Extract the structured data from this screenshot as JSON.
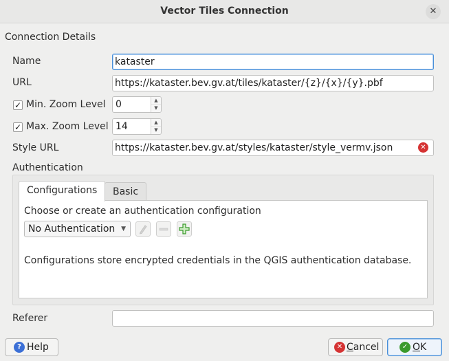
{
  "window": {
    "title": "Vector Tiles Connection",
    "close_glyph": "✕"
  },
  "connection": {
    "group_title": "Connection Details",
    "name_label": "Name",
    "name_value": "kataster",
    "url_label": "URL",
    "url_value": "https://kataster.bev.gv.at/tiles/kataster/{z}/{x}/{y}.pbf",
    "min_zoom_label": "Min. Zoom Level",
    "min_zoom_checked": true,
    "min_zoom_value": "0",
    "max_zoom_label": "Max. Zoom Level",
    "max_zoom_checked": true,
    "max_zoom_value": "14",
    "style_url_label": "Style URL",
    "style_url_value": "https://kataster.bev.gv.at/styles/kataster/style_vermv.json",
    "check_glyph": "✓"
  },
  "authentication": {
    "group_title": "Authentication",
    "tabs": [
      {
        "label": "Configurations",
        "active": true
      },
      {
        "label": "Basic",
        "active": false
      }
    ],
    "choose_text": "Choose or create an authentication configuration",
    "selected_config": "No Authentication",
    "info_text": "Configurations store encrypted credentials in the QGIS authentication database."
  },
  "referer": {
    "label": "Referer",
    "value": ""
  },
  "buttons": {
    "help": "Help",
    "cancel": "Cancel",
    "ok": "OK"
  },
  "icons": {
    "clear": "clear-field-icon",
    "edit": "pencil-icon",
    "remove": "remove-icon",
    "add": "green-plus-icon",
    "help": "question-icon",
    "cancel": "red-x-icon",
    "ok": "green-check-icon"
  },
  "colors": {
    "focus": "#4a90d9",
    "add_green": "#3a9a2c",
    "clear_red": "#d53333",
    "help_blue": "#3b6fd6"
  }
}
